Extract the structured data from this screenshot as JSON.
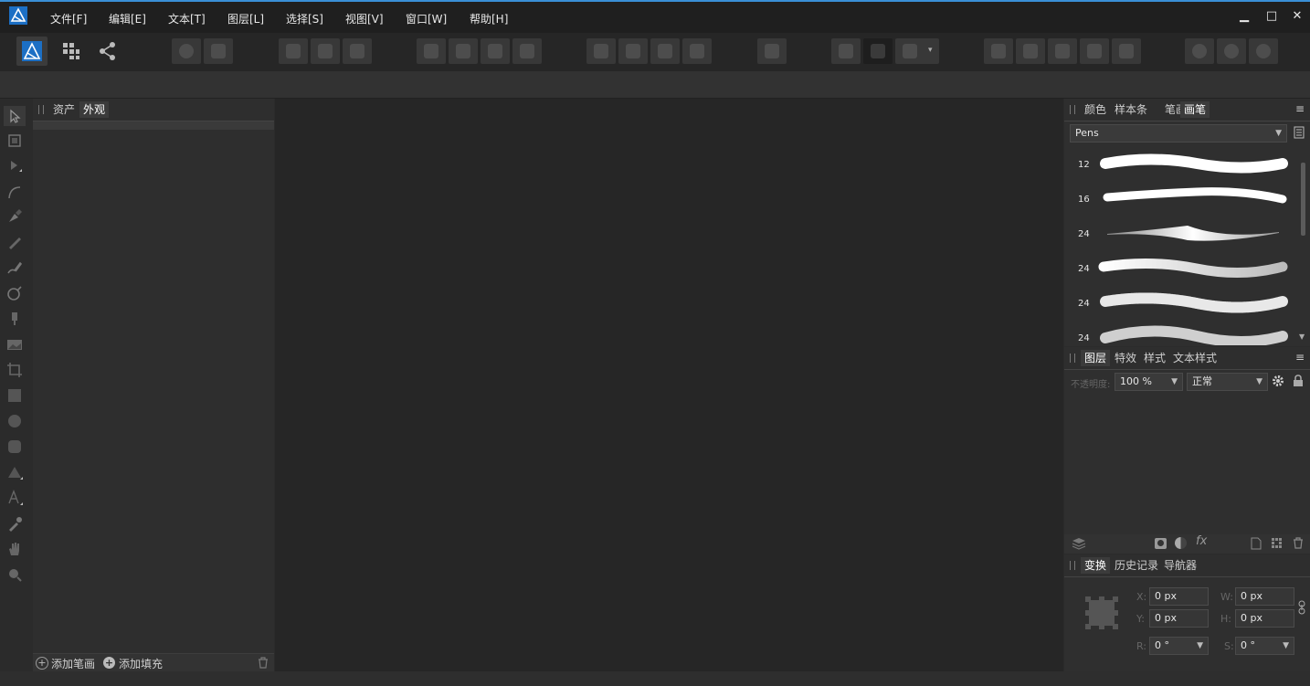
{
  "menu": [
    "文件[F]",
    "编辑[E]",
    "文本[T]",
    "图层[L]",
    "选择[S]",
    "视图[V]",
    "窗口[W]",
    "帮助[H]"
  ],
  "window_controls": {
    "minimize": "▁",
    "maximize": "□",
    "close": "✕"
  },
  "left_panel": {
    "tabs": [
      "资产",
      "外观"
    ],
    "active_tab": "外观",
    "add_stroke": "添加笔画",
    "add_fill": "添加填充"
  },
  "brushes_panel": {
    "tabs": [
      "颜色",
      "样本条",
      "笔画",
      "画笔"
    ],
    "active_tab": "画笔",
    "category": "Pens",
    "brushes": [
      {
        "size": "12"
      },
      {
        "size": "16"
      },
      {
        "size": "24"
      },
      {
        "size": "24"
      },
      {
        "size": "24"
      },
      {
        "size": "24"
      }
    ]
  },
  "layers_panel": {
    "tabs": [
      "图层",
      "特效",
      "样式",
      "文本样式"
    ],
    "active_tab": "图层",
    "opacity_label": "不透明度:",
    "opacity_value": "100 %",
    "blend_mode": "正常"
  },
  "transform_panel": {
    "tabs": [
      "变换",
      "历史记录",
      "导航器"
    ],
    "active_tab": "变换",
    "x_label": "X:",
    "x_value": "0 px",
    "y_label": "Y:",
    "y_value": "0 px",
    "w_label": "W:",
    "w_value": "0 px",
    "h_label": "H:",
    "h_value": "0 px",
    "r_label": "R:",
    "r_value": "0 °",
    "s_label": "S:",
    "s_value": "0 °"
  },
  "colors": {
    "accent": "#3a8fd6",
    "background": "#2b2b2b",
    "canvas": "#262626"
  }
}
